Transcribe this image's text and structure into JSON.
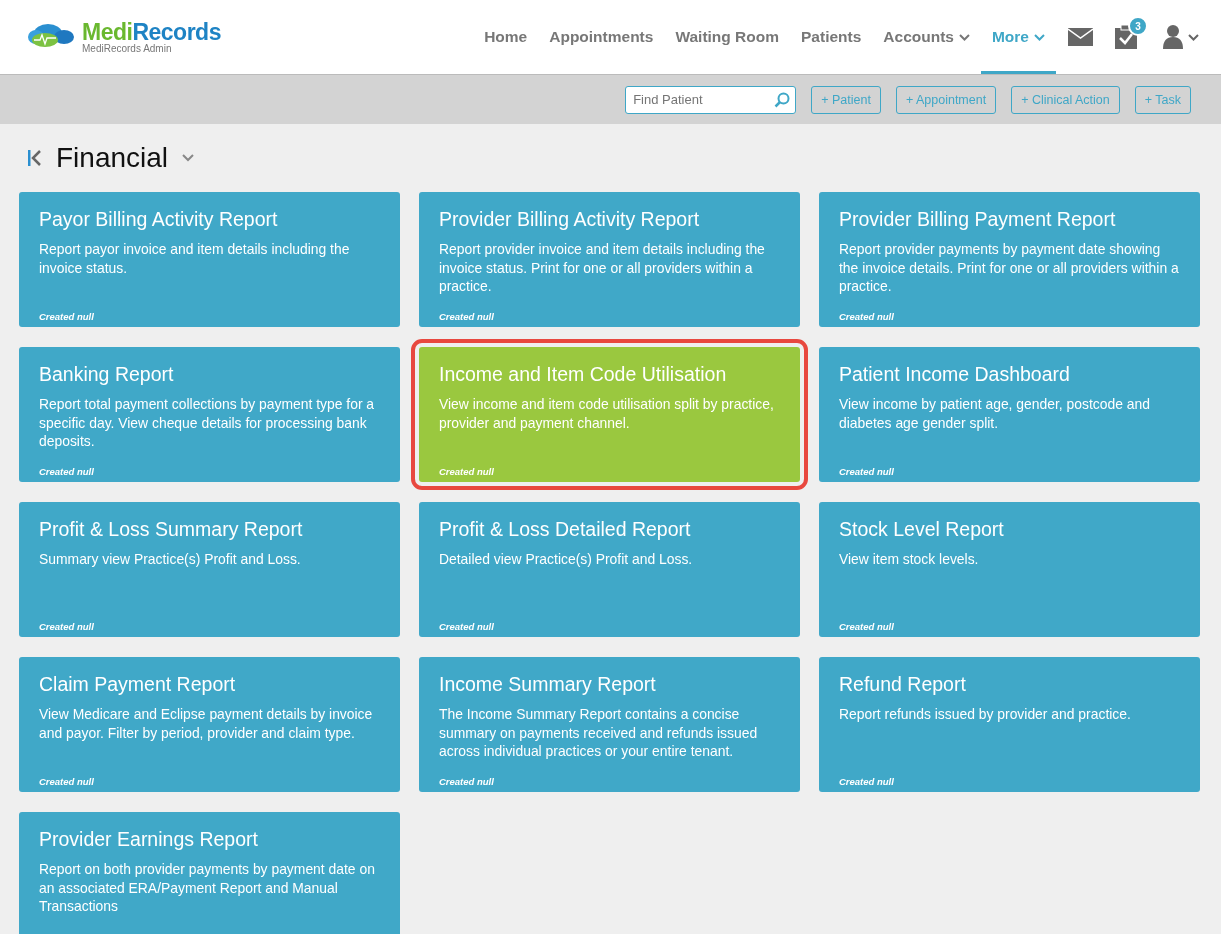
{
  "logo": {
    "brand_part_1": "Medi",
    "brand_part_2": "Records",
    "subtitle": "MediRecords Admin"
  },
  "nav": [
    {
      "label": "Home",
      "selected": false,
      "dropdown": false
    },
    {
      "label": "Appointments",
      "selected": false,
      "dropdown": false
    },
    {
      "label": "Waiting Room",
      "selected": false,
      "dropdown": false
    },
    {
      "label": "Patients",
      "selected": false,
      "dropdown": false
    },
    {
      "label": "Accounts",
      "selected": false,
      "dropdown": true
    },
    {
      "label": "More",
      "selected": true,
      "dropdown": true
    }
  ],
  "tasks_badge": "3",
  "toolbar": {
    "search": {
      "placeholder": "Find Patient"
    },
    "buttons": [
      "+ Patient",
      "+ Appointment",
      "+ Clinical Action",
      "+ Task"
    ]
  },
  "page_title": "Financial",
  "cards": [
    {
      "title": "Payor Billing Activity Report",
      "description": "Report payor invoice and item details including the invoice status.",
      "footer": "Created null",
      "selected": false
    },
    {
      "title": "Provider Billing Activity Report",
      "description": "Report provider invoice and item details including the invoice status. Print for one or all providers within a practice.",
      "footer": "Created null",
      "selected": false
    },
    {
      "title": "Provider Billing Payment Report",
      "description": "Report provider payments by payment date showing the invoice details. Print for one or all providers within a practice.",
      "footer": "Created null",
      "selected": false
    },
    {
      "title": "Banking Report",
      "description": "Report total payment collections by payment type for a specific day. View cheque details for processing bank deposits.",
      "footer": "Created null",
      "selected": false
    },
    {
      "title": "Income and Item Code Utilisation",
      "description": "View income and item code utilisation split by practice, provider and payment channel.",
      "footer": "Created null",
      "selected": true
    },
    {
      "title": "Patient Income Dashboard",
      "description": "View income by patient age, gender, postcode and diabetes age gender split.",
      "footer": "Created null",
      "selected": false
    },
    {
      "title": "Profit & Loss Summary Report",
      "description": "Summary view Practice(s) Profit and Loss.",
      "footer": "Created null",
      "selected": false
    },
    {
      "title": "Profit & Loss Detailed Report",
      "description": "Detailed view Practice(s) Profit and Loss.",
      "footer": "Created null",
      "selected": false
    },
    {
      "title": "Stock Level Report",
      "description": "View item stock levels.",
      "footer": "Created null",
      "selected": false
    },
    {
      "title": "Claim Payment Report",
      "description": "View Medicare and Eclipse payment details by invoice and payor. Filter by period, provider and claim type.",
      "footer": "Created null",
      "selected": false
    },
    {
      "title": "Income Summary Report",
      "description": "The Income Summary Report contains a concise summary on payments received and refunds issued across individual practices or your entire tenant.",
      "footer": "Created null",
      "selected": false
    },
    {
      "title": "Refund Report",
      "description": "Report refunds issued by provider and practice.",
      "footer": "Created null",
      "selected": false
    },
    {
      "title": "Provider Earnings Report",
      "description": "Report on both provider payments by payment date on an associated ERA/Payment Report and Manual Transactions",
      "selected": false
    }
  ]
}
